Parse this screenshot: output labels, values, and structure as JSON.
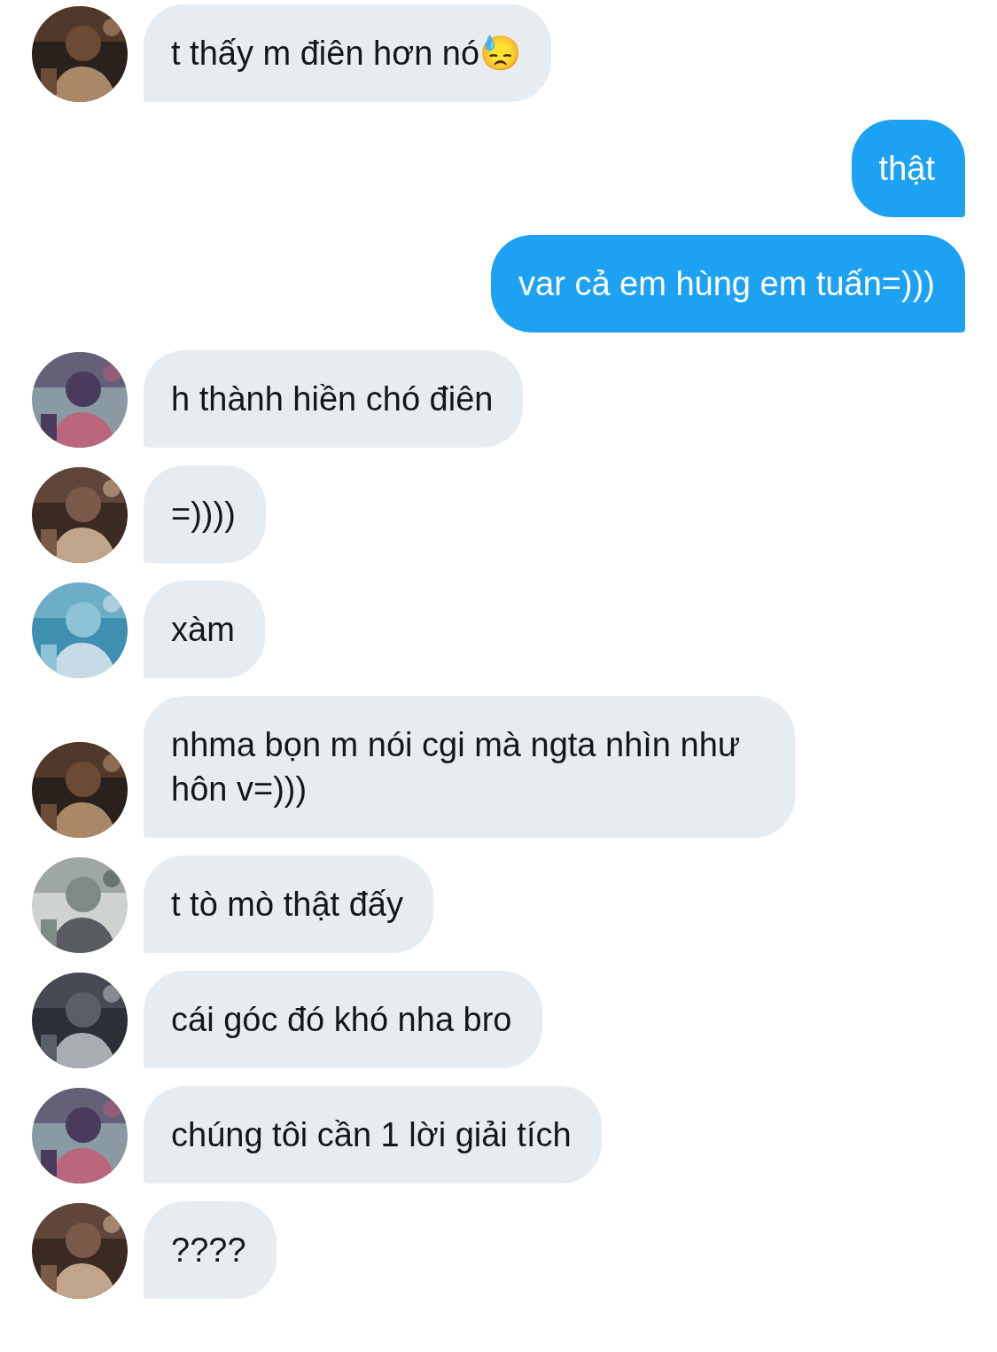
{
  "messages": [
    {
      "kind": "incoming",
      "text": "t thấy m điên hơn nó😓"
    },
    {
      "kind": "outgoing",
      "text": "thật"
    },
    {
      "kind": "outgoing",
      "text": "var cả em hùng em tuấn=)))"
    },
    {
      "kind": "incoming",
      "text": "h thành hiền chó điên"
    },
    {
      "kind": "incoming",
      "text": "=))))"
    },
    {
      "kind": "incoming",
      "text": "xàm"
    },
    {
      "kind": "incoming",
      "text": "nhma bọn m nói cgi mà ngta nhìn như hôn v=)))"
    },
    {
      "kind": "incoming",
      "text": "t tò mò thật đấy"
    },
    {
      "kind": "incoming",
      "text": "cái góc đó khó nha bro"
    },
    {
      "kind": "incoming",
      "text": "chúng tôi cần 1 lời giải tích"
    },
    {
      "kind": "incoming",
      "text": "????"
    }
  ]
}
